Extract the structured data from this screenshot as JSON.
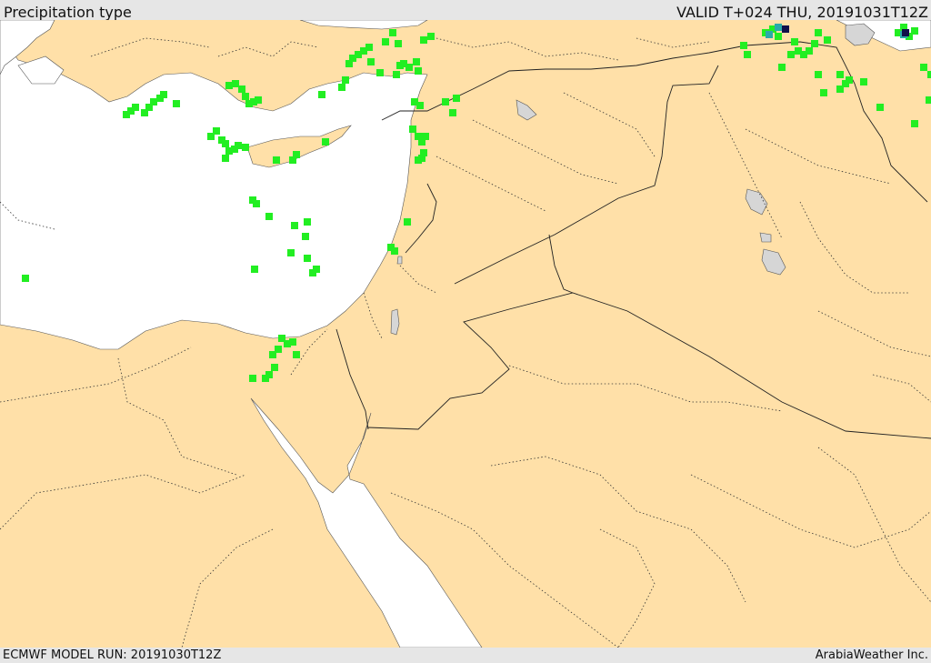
{
  "header": {
    "title": "Precipitation type",
    "valid_time": "VALID T+024 THU, 20191031T12Z"
  },
  "footer": {
    "model_run": "ECMWF MODEL RUN: 20191030T12Z",
    "credit": "ArabiaWeather Inc."
  },
  "map": {
    "colors": {
      "land": "#ffe0a8",
      "water": "#ffffff",
      "lake": "#d6d6d6",
      "border": "#222222",
      "rain": "#22ee22",
      "mixed": "#2aaaaa",
      "snow": "#10104a"
    },
    "precip_type_colors": [
      "rain",
      "mixed",
      "snow"
    ]
  }
}
